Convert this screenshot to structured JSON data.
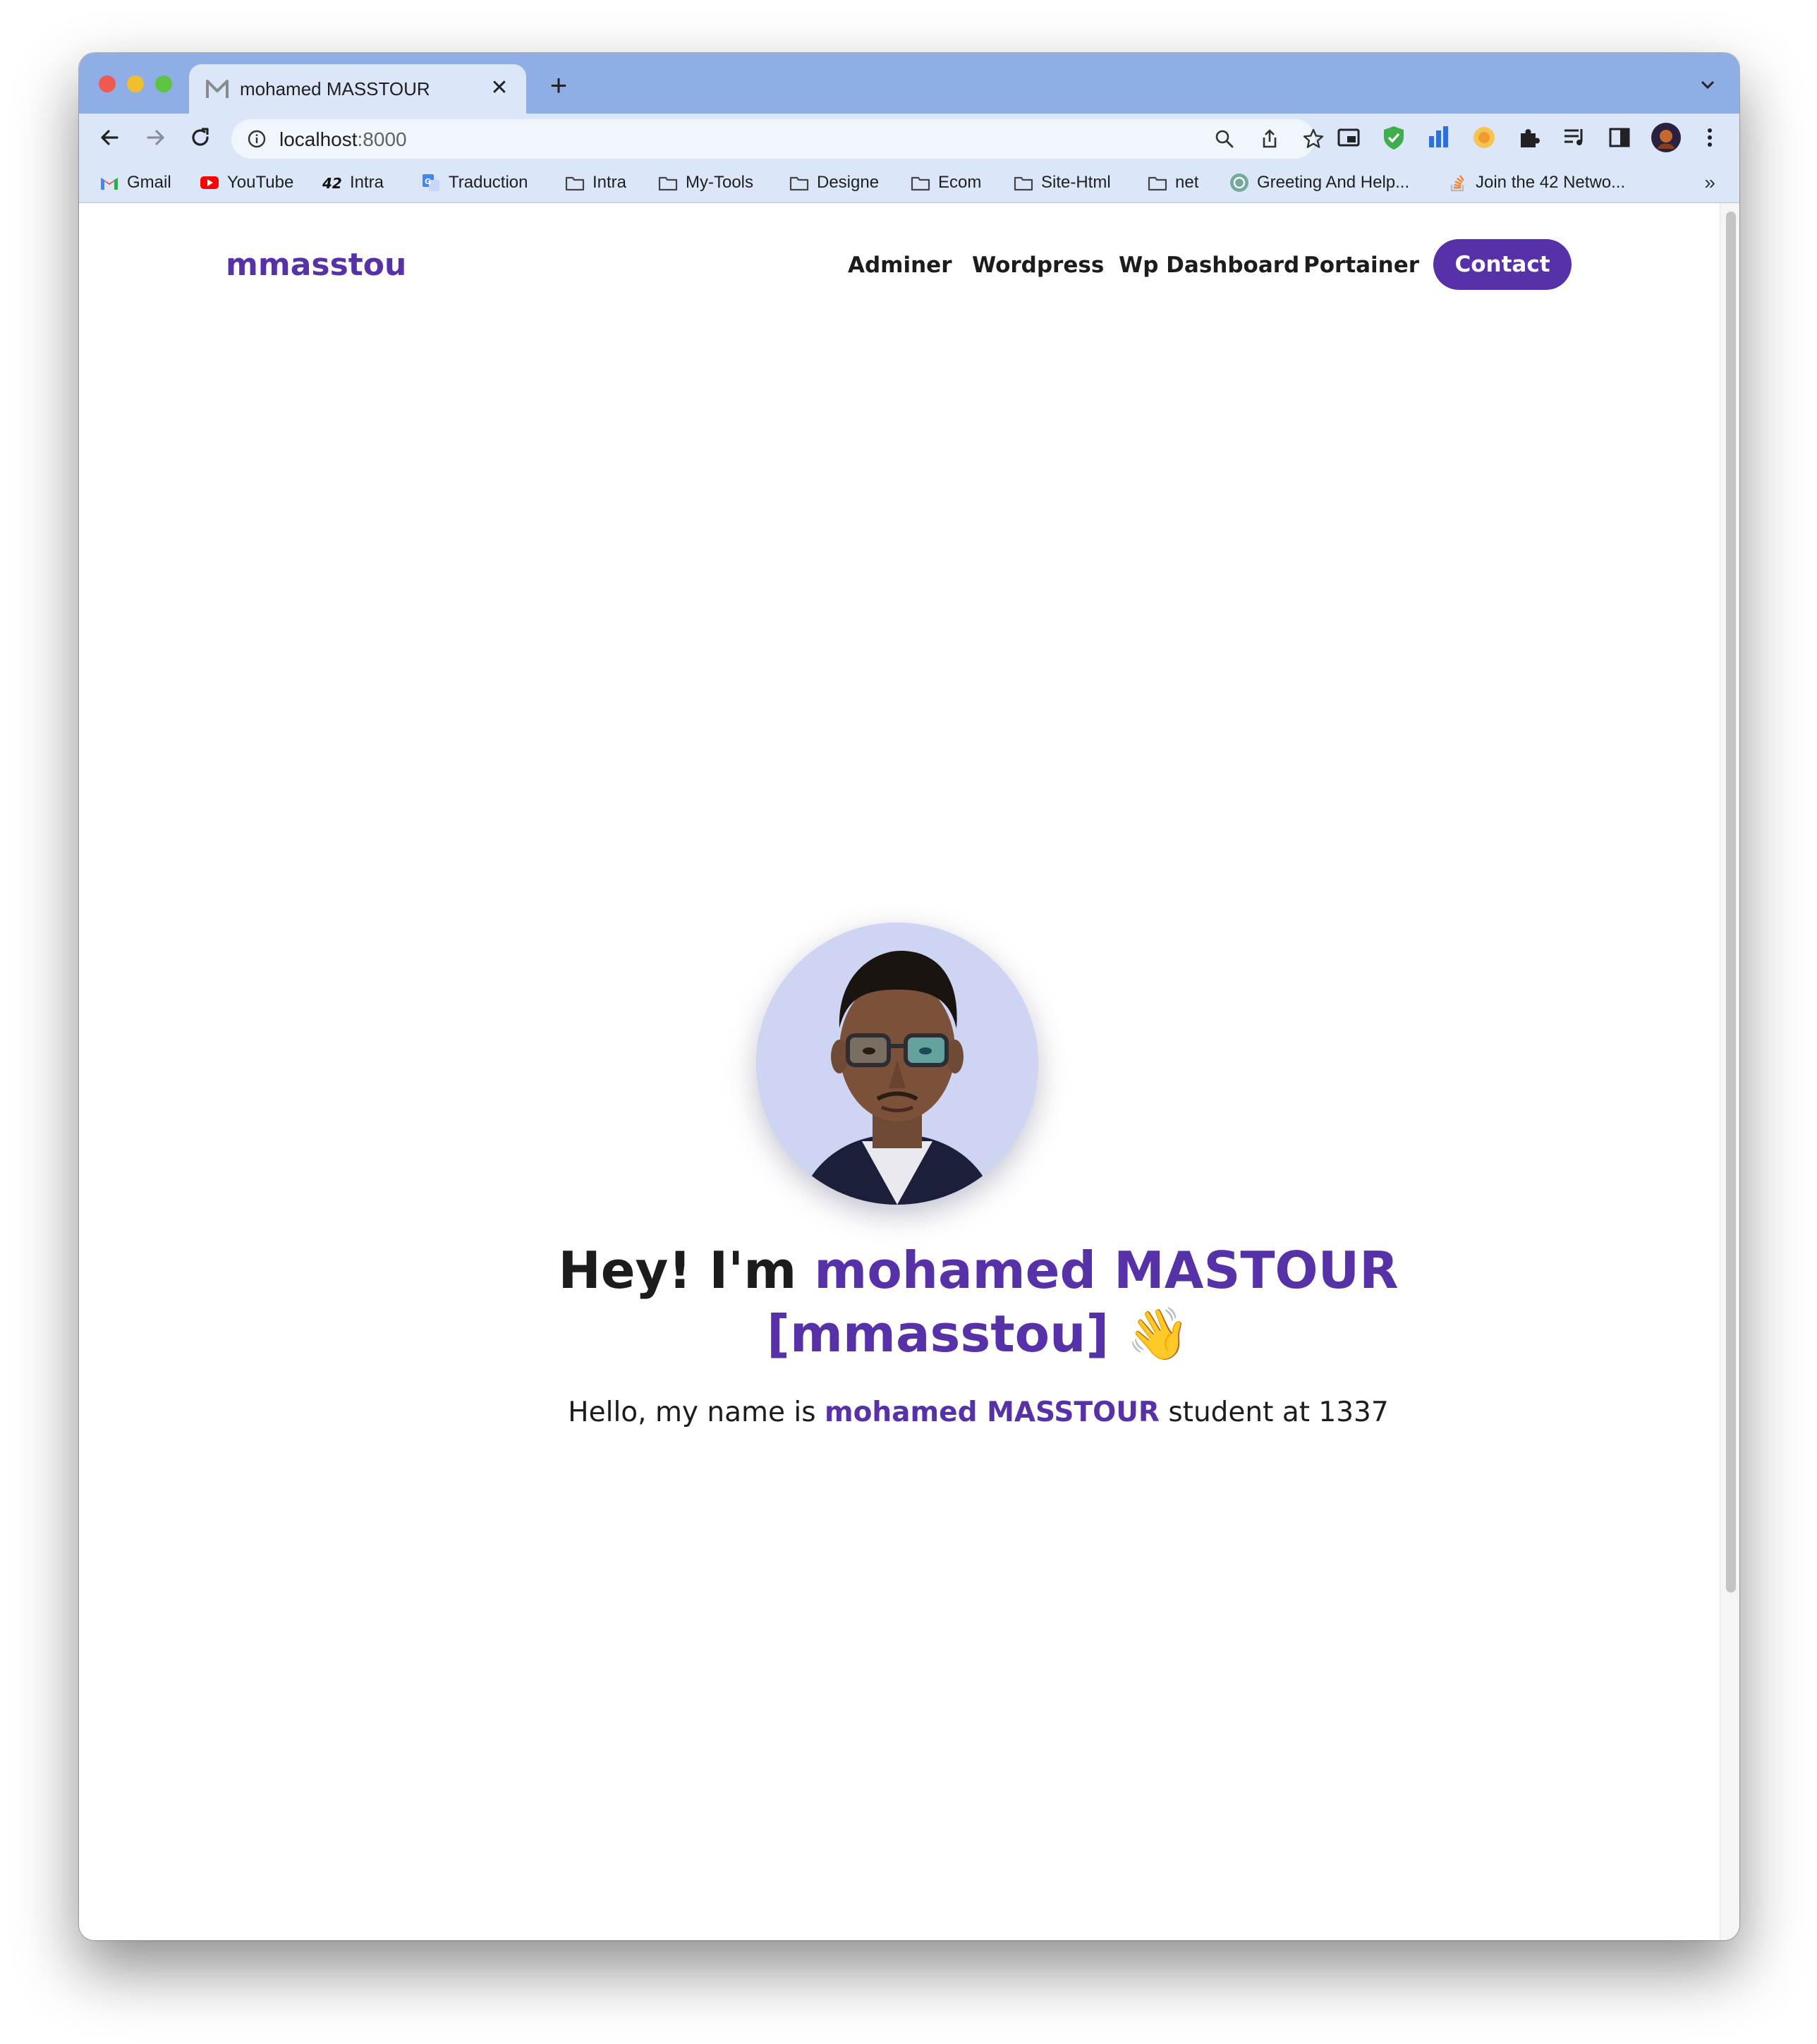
{
  "browser": {
    "tab": {
      "title": "mohamed MASSTOUR",
      "close_glyph": "✕",
      "favicon": "m-logo-icon"
    },
    "new_tab_glyph": "+",
    "url": {
      "host": "localhost",
      "port": ":8000"
    },
    "bookmarks": [
      {
        "label": "Gmail",
        "icon": "gmail-icon"
      },
      {
        "label": "YouTube",
        "icon": "youtube-icon"
      },
      {
        "label": "Intra",
        "icon": "42-icon"
      },
      {
        "label": "Traduction",
        "icon": "translate-icon"
      },
      {
        "label": "Intra",
        "icon": "folder-icon"
      },
      {
        "label": "My-Tools",
        "icon": "folder-icon"
      },
      {
        "label": "Designe",
        "icon": "folder-icon"
      },
      {
        "label": "Ecom",
        "icon": "folder-icon"
      },
      {
        "label": "Site-Html",
        "icon": "folder-icon"
      },
      {
        "label": "net",
        "icon": "folder-icon"
      },
      {
        "label": "Greeting And Help...",
        "icon": "chatgpt-icon"
      },
      {
        "label": "Join the 42 Netwo...",
        "icon": "stackoverflow-icon"
      }
    ],
    "bookmarks_more": "»"
  },
  "site": {
    "brand": "mmasstou",
    "nav": [
      "Adminer",
      "Wordpress",
      "Wp Dashboard",
      "Portainer"
    ],
    "contact_label": "Contact",
    "hero": {
      "greeting": "Hey! I'm ",
      "name": "mohamed MASTOUR",
      "handle": "[mmasstou]",
      "wave": "👋",
      "sub_prefix": "Hello, my name is ",
      "sub_name": "mohamed MASSTOUR",
      "sub_suffix": " student at 1337"
    }
  },
  "colors": {
    "accent": "#5631a8",
    "tab_strip": "#90aee6",
    "toolbar": "#dbe6f8"
  }
}
